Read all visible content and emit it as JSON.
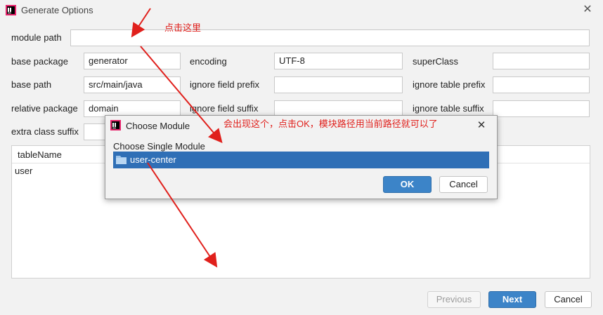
{
  "window": {
    "title": "Generate Options",
    "close_icon": "close-icon"
  },
  "form": {
    "module_path": {
      "label": "module path",
      "value": ""
    },
    "base_package": {
      "label": "base package",
      "value": "generator"
    },
    "encoding": {
      "label": "encoding",
      "value": "UTF-8"
    },
    "super_class": {
      "label": "superClass",
      "value": ""
    },
    "base_path": {
      "label": "base path",
      "value": "src/main/java"
    },
    "ignore_field_prefix": {
      "label": "ignore field prefix",
      "value": ""
    },
    "ignore_table_prefix": {
      "label": "ignore table prefix",
      "value": ""
    },
    "relative_package": {
      "label": "relative package",
      "value": "domain"
    },
    "ignore_field_suffix": {
      "label": "ignore field suffix",
      "value": ""
    },
    "ignore_table_suffix": {
      "label": "ignore table suffix",
      "value": ""
    },
    "extra_class_suffix": {
      "label": "extra class suffix",
      "value": ""
    }
  },
  "table": {
    "header": "tableName",
    "rows": [
      "user"
    ]
  },
  "footer": {
    "previous": "Previous",
    "next": "Next",
    "cancel": "Cancel"
  },
  "dialog": {
    "title": "Choose Module",
    "section_label": "Choose Single Module",
    "selected_module": "user-center",
    "ok": "OK",
    "cancel": "Cancel",
    "close_icon": "close-icon",
    "module_icon": "folder-icon"
  },
  "annotations": {
    "click_here": "点击这里",
    "instruction": "会出现这个，点击OK，模块路径用当前路径就可以了"
  },
  "colors": {
    "annotation": "#e0201c",
    "selection": "#2f6fb6",
    "primary_button": "#3c84c8"
  }
}
